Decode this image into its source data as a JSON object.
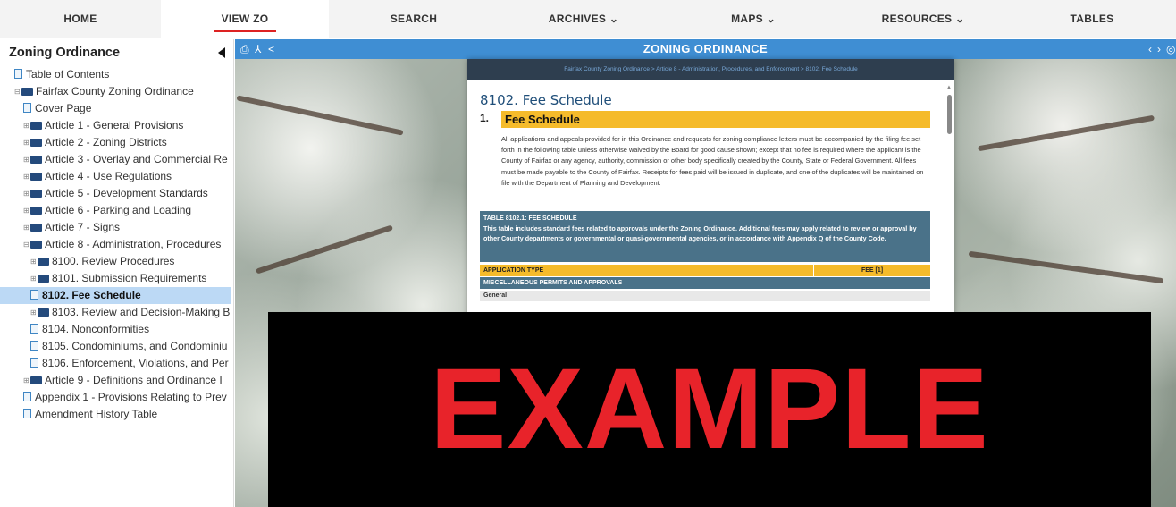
{
  "nav": {
    "items": [
      {
        "label": "HOME"
      },
      {
        "label": "VIEW ZO"
      },
      {
        "label": "SEARCH"
      },
      {
        "label": "ARCHIVES ⌄"
      },
      {
        "label": "MAPS ⌄"
      },
      {
        "label": "RESOURCES ⌄"
      },
      {
        "label": "TABLES"
      }
    ],
    "active_index": 1,
    "accent_color": "#dd2222"
  },
  "sidebar": {
    "title": "Zoning Ordinance",
    "items": [
      {
        "label": "Table of Contents",
        "icon": "doc-icon"
      },
      {
        "label": "Fairfax County Zoning Ordinance",
        "icon": "folder-icon"
      },
      {
        "label": "Cover Page",
        "icon": "doc-icon"
      },
      {
        "label": "Article 1 - General Provisions",
        "icon": "folder-icon"
      },
      {
        "label": "Article 2 - Zoning Districts",
        "icon": "folder-icon"
      },
      {
        "label": "Article 3 - Overlay and Commercial Re",
        "icon": "folder-icon"
      },
      {
        "label": "Article 4 - Use Regulations",
        "icon": "folder-icon"
      },
      {
        "label": "Article 5 - Development Standards",
        "icon": "folder-icon"
      },
      {
        "label": "Article 6 - Parking and Loading",
        "icon": "folder-icon"
      },
      {
        "label": "Article 7 - Signs",
        "icon": "folder-icon"
      },
      {
        "label": "Article 8 - Administration, Procedures",
        "icon": "folder-icon"
      },
      {
        "label": "8100. Review Procedures",
        "icon": "folder-icon"
      },
      {
        "label": "8101. Submission Requirements",
        "icon": "folder-icon"
      },
      {
        "label": "8102. Fee Schedule",
        "icon": "doc-icon"
      },
      {
        "label": "8103. Review and Decision-Making B",
        "icon": "folder-icon"
      },
      {
        "label": "8104. Nonconformities",
        "icon": "doc-icon"
      },
      {
        "label": "8105. Condominiums, and Condominiu",
        "icon": "doc-icon"
      },
      {
        "label": "8106. Enforcement, Violations, and Per",
        "icon": "doc-icon"
      },
      {
        "label": "Article 9 - Definitions and Ordinance I",
        "icon": "folder-icon"
      },
      {
        "label": "Appendix 1 - Provisions Relating to Prev",
        "icon": "doc-icon"
      },
      {
        "label": "Amendment History Table",
        "icon": "doc-icon"
      }
    ],
    "selected_index": 13
  },
  "viewer": {
    "title": "ZONING ORDINANCE",
    "icons": [
      "print-icon",
      "pdf-icon",
      "share-icon",
      "prev-icon",
      "next-icon",
      "settings-icon"
    ],
    "bar_color": "#3f8ed3"
  },
  "document": {
    "breadcrumb": "Fairfax County Zoning Ordinance > Article 8 - Administration, Procedures, and Enforcement > 8102. Fee Schedule",
    "heading": "8102. Fee Schedule",
    "section_number": "1.",
    "section_title": "Fee Schedule",
    "paragraph": "All applications and appeals provided for in this Ordinance and requests for zoning compliance letters must be accompanied by the filing fee set forth in the following table unless otherwise waived by the Board for good cause shown; except that no fee is required where the applicant is the County of Fairfax or any agency, authority, commission or other body specifically created by the County, State or Federal Government. All fees must be made payable to the County of Fairfax. Receipts for fees paid will be issued in duplicate, and one of the duplicates will be maintained on file with the Department of Planning and Development.",
    "table_caption_label": "TABLE 8102.1: FEE SCHEDULE",
    "table_caption_text": "This table includes standard fees related to approvals under the Zoning Ordinance. Additional fees may apply related to review or approval by other County departments or governmental or quasi-governmental agencies, or in accordance with Appendix Q of the County Code.",
    "col_application": "APPLICATION TYPE",
    "col_fee": "FEE [1]",
    "section_row": "MISCELLANEOUS PERMITS AND APPROVALS",
    "subsection_row": "General",
    "highlight_color": "#f5bb2b",
    "table_color": "#4a7289"
  },
  "overlay": {
    "stamp_text": "EXAMPLE",
    "stamp_color": "#e8232a"
  }
}
